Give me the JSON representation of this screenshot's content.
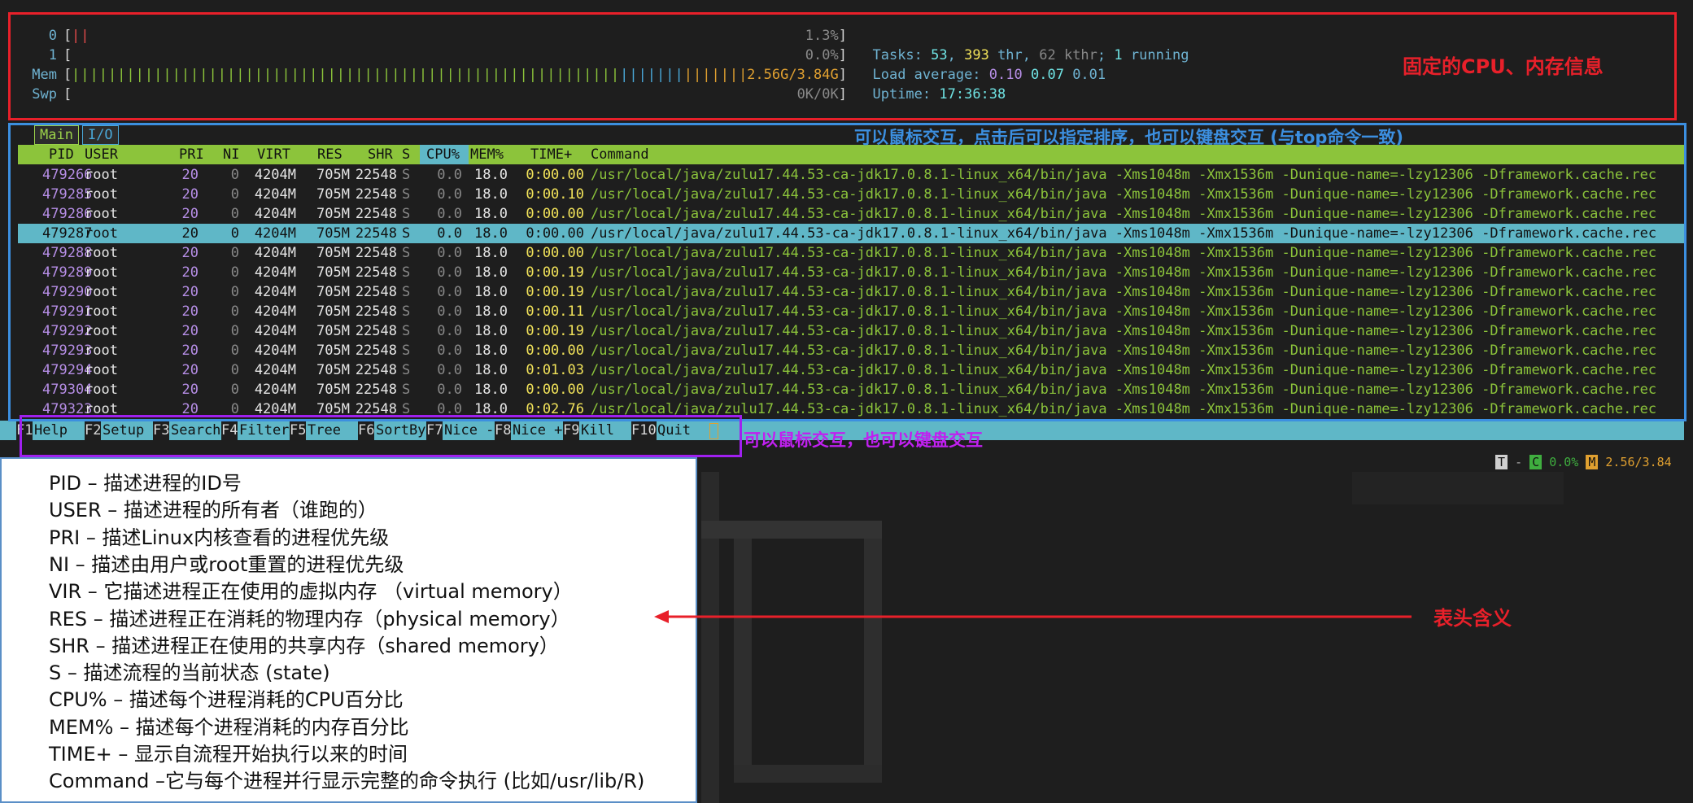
{
  "meters": [
    {
      "label": "0",
      "fill": "||",
      "fill_color": "#e04a4a",
      "value": "1.3%",
      "fraction": 0.003
    },
    {
      "label": "1",
      "fill": "",
      "fill_color": "#e04a4a",
      "value": "0.0%",
      "fraction": 0.0
    },
    {
      "label": "Mem",
      "fill": "|||||||||||||||||||||||||||||||||||||||||||||||||||||||||||||||||||||||||||||||||||",
      "fill_color": "#8cc43b",
      "value": "2.56G/3.84G",
      "fraction": 0.67
    },
    {
      "label": "Swp",
      "fill": "",
      "fill_color": "#e04a4a",
      "value": "0K/0K",
      "fraction": 0.0
    }
  ],
  "info": {
    "tasks_label": "Tasks: ",
    "tasks": "53",
    "sep1": ", ",
    "thr": "393",
    "thr_label": " thr, ",
    "kthr": "62 kthr",
    "sep2": "; ",
    "running": "1",
    "running_label": " running",
    "load_label": "Load average: ",
    "load1": "0.10",
    "load5": "0.07",
    "load15": "0.01",
    "uptime_label": "Uptime: ",
    "uptime": "17:36:38"
  },
  "tabs": {
    "main": "Main",
    "io": "I/O"
  },
  "columns": {
    "pid": "PID",
    "user": "USER",
    "pri": "PRI",
    "ni": "NI",
    "virt": "VIRT",
    "res": "RES",
    "shr": "SHR",
    "s": "S",
    "cpu": "CPU%",
    "mem": "MEM%",
    "time": "TIME+",
    "cmd": "Command"
  },
  "processes": [
    {
      "pid": "479266",
      "user": "root",
      "pri": "20",
      "ni": "0",
      "virt": "4204M",
      "res": "705M",
      "shr": "22548",
      "s": "S",
      "cpu": "0.0",
      "mem": "18.0",
      "time": "0:00.00",
      "cmd": "/usr/local/java/zulu17.44.53-ca-jdk17.0.8.1-linux_x64/bin/java -Xms1048m -Xmx1536m -Dunique-name=-lzy12306 -Dframework.cache.rec"
    },
    {
      "pid": "479285",
      "user": "root",
      "pri": "20",
      "ni": "0",
      "virt": "4204M",
      "res": "705M",
      "shr": "22548",
      "s": "S",
      "cpu": "0.0",
      "mem": "18.0",
      "time": "0:00.10",
      "cmd": "/usr/local/java/zulu17.44.53-ca-jdk17.0.8.1-linux_x64/bin/java -Xms1048m -Xmx1536m -Dunique-name=-lzy12306 -Dframework.cache.rec"
    },
    {
      "pid": "479286",
      "user": "root",
      "pri": "20",
      "ni": "0",
      "virt": "4204M",
      "res": "705M",
      "shr": "22548",
      "s": "S",
      "cpu": "0.0",
      "mem": "18.0",
      "time": "0:00.00",
      "cmd": "/usr/local/java/zulu17.44.53-ca-jdk17.0.8.1-linux_x64/bin/java -Xms1048m -Xmx1536m -Dunique-name=-lzy12306 -Dframework.cache.rec"
    },
    {
      "pid": "479287",
      "user": "root",
      "pri": "20",
      "ni": "0",
      "virt": "4204M",
      "res": "705M",
      "shr": "22548",
      "s": "S",
      "cpu": "0.0",
      "mem": "18.0",
      "time": "0:00.00",
      "cmd": "/usr/local/java/zulu17.44.53-ca-jdk17.0.8.1-linux_x64/bin/java -Xms1048m -Xmx1536m -Dunique-name=-lzy12306 -Dframework.cache.rec"
    },
    {
      "pid": "479288",
      "user": "root",
      "pri": "20",
      "ni": "0",
      "virt": "4204M",
      "res": "705M",
      "shr": "22548",
      "s": "S",
      "cpu": "0.0",
      "mem": "18.0",
      "time": "0:00.00",
      "cmd": "/usr/local/java/zulu17.44.53-ca-jdk17.0.8.1-linux_x64/bin/java -Xms1048m -Xmx1536m -Dunique-name=-lzy12306 -Dframework.cache.rec"
    },
    {
      "pid": "479289",
      "user": "root",
      "pri": "20",
      "ni": "0",
      "virt": "4204M",
      "res": "705M",
      "shr": "22548",
      "s": "S",
      "cpu": "0.0",
      "mem": "18.0",
      "time": "0:00.19",
      "cmd": "/usr/local/java/zulu17.44.53-ca-jdk17.0.8.1-linux_x64/bin/java -Xms1048m -Xmx1536m -Dunique-name=-lzy12306 -Dframework.cache.rec"
    },
    {
      "pid": "479290",
      "user": "root",
      "pri": "20",
      "ni": "0",
      "virt": "4204M",
      "res": "705M",
      "shr": "22548",
      "s": "S",
      "cpu": "0.0",
      "mem": "18.0",
      "time": "0:00.19",
      "cmd": "/usr/local/java/zulu17.44.53-ca-jdk17.0.8.1-linux_x64/bin/java -Xms1048m -Xmx1536m -Dunique-name=-lzy12306 -Dframework.cache.rec"
    },
    {
      "pid": "479291",
      "user": "root",
      "pri": "20",
      "ni": "0",
      "virt": "4204M",
      "res": "705M",
      "shr": "22548",
      "s": "S",
      "cpu": "0.0",
      "mem": "18.0",
      "time": "0:00.11",
      "cmd": "/usr/local/java/zulu17.44.53-ca-jdk17.0.8.1-linux_x64/bin/java -Xms1048m -Xmx1536m -Dunique-name=-lzy12306 -Dframework.cache.rec"
    },
    {
      "pid": "479292",
      "user": "root",
      "pri": "20",
      "ni": "0",
      "virt": "4204M",
      "res": "705M",
      "shr": "22548",
      "s": "S",
      "cpu": "0.0",
      "mem": "18.0",
      "time": "0:00.19",
      "cmd": "/usr/local/java/zulu17.44.53-ca-jdk17.0.8.1-linux_x64/bin/java -Xms1048m -Xmx1536m -Dunique-name=-lzy12306 -Dframework.cache.rec"
    },
    {
      "pid": "479293",
      "user": "root",
      "pri": "20",
      "ni": "0",
      "virt": "4204M",
      "res": "705M",
      "shr": "22548",
      "s": "S",
      "cpu": "0.0",
      "mem": "18.0",
      "time": "0:00.00",
      "cmd": "/usr/local/java/zulu17.44.53-ca-jdk17.0.8.1-linux_x64/bin/java -Xms1048m -Xmx1536m -Dunique-name=-lzy12306 -Dframework.cache.rec"
    },
    {
      "pid": "479294",
      "user": "root",
      "pri": "20",
      "ni": "0",
      "virt": "4204M",
      "res": "705M",
      "shr": "22548",
      "s": "S",
      "cpu": "0.0",
      "mem": "18.0",
      "time": "0:01.03",
      "cmd": "/usr/local/java/zulu17.44.53-ca-jdk17.0.8.1-linux_x64/bin/java -Xms1048m -Xmx1536m -Dunique-name=-lzy12306 -Dframework.cache.rec"
    },
    {
      "pid": "479304",
      "user": "root",
      "pri": "20",
      "ni": "0",
      "virt": "4204M",
      "res": "705M",
      "shr": "22548",
      "s": "S",
      "cpu": "0.0",
      "mem": "18.0",
      "time": "0:00.00",
      "cmd": "/usr/local/java/zulu17.44.53-ca-jdk17.0.8.1-linux_x64/bin/java -Xms1048m -Xmx1536m -Dunique-name=-lzy12306 -Dframework.cache.rec"
    },
    {
      "pid": "479323",
      "user": "root",
      "pri": "20",
      "ni": "0",
      "virt": "4204M",
      "res": "705M",
      "shr": "22548",
      "s": "S",
      "cpu": "0.0",
      "mem": "18.0",
      "time": "0:02.76",
      "cmd": "/usr/local/java/zulu17.44.53-ca-jdk17.0.8.1-linux_x64/bin/java -Xms1048m -Xmx1536m -Dunique-name=-lzy12306 -Dframework.cache.rec"
    }
  ],
  "selected_row": 3,
  "footer": [
    {
      "key": "F1",
      "label": "Help"
    },
    {
      "key": "F2",
      "label": "Setup"
    },
    {
      "key": "F3",
      "label": "Search"
    },
    {
      "key": "F4",
      "label": "Filter"
    },
    {
      "key": "F5",
      "label": "Tree"
    },
    {
      "key": "F6",
      "label": "SortBy"
    },
    {
      "key": "F7",
      "label": "Nice -"
    },
    {
      "key": "F8",
      "label": "Nice +"
    },
    {
      "key": "F9",
      "label": "Kill"
    },
    {
      "key": "F10",
      "label": "Quit"
    }
  ],
  "status": {
    "t": "T",
    "sep": "-",
    "c": "C",
    "cpu": "0.0%",
    "m": "M",
    "mem": "2.56/3.84"
  },
  "annotations": {
    "meters_note": "固定的CPU、内存信息",
    "table_note": "可以鼠标交互，点击后可以指定排序，也可以键盘交互 (与top命令一致)",
    "footer_note": "可以鼠标交互，也可以键盘交互",
    "header_note": "表头含义"
  },
  "legend": [
    "PID – 描述进程的ID号",
    "USER – 描述进程的所有者（谁跑的）",
    "PRI – 描述Linux内核查看的进程优先级",
    "NI – 描述由用户或root重置的进程优先级",
    "VIR – 它描述进程正在使用的虚拟内存 （virtual memory）",
    "RES – 描述进程正在消耗的物理内存（physical memory）",
    "SHR – 描述进程正在使用的共享内存（shared memory）",
    "S – 描述流程的当前状态 (state)",
    "CPU% – 描述每个进程消耗的CPU百分比",
    "MEM% – 描述每个进程消耗的内存百分比",
    "TIME+ – 显示自流程开始执行以来的时间",
    "Command –它与每个进程并行显示完整的命令执行 (比如/usr/lib/R)"
  ],
  "colors": {
    "meters_box": "#e8202a",
    "table_box": "#3c8fe0",
    "footer_box": "#a020f0",
    "header_bg": "#8cc43b",
    "selected_bg": "#5fb7c7"
  }
}
